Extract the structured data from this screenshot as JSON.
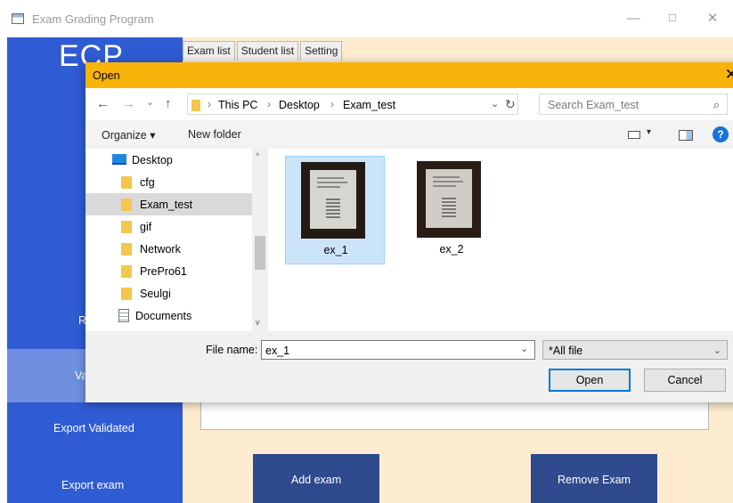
{
  "window": {
    "title": "Exam Grading Program",
    "minimize_glyph": "—",
    "maximize_glyph": "☐",
    "close_glyph": "✕"
  },
  "sidebar": {
    "logo": "ECP",
    "items": [
      {
        "label": "R"
      },
      {
        "label": "Va"
      },
      {
        "label": "Export Validated"
      },
      {
        "label": "Export exam"
      }
    ]
  },
  "tabs": [
    "Exam list",
    "Student list",
    "Setting"
  ],
  "buttons": {
    "add_exam": "Add exam",
    "remove_exam": "Remove Exam"
  },
  "dialog": {
    "title": "Open",
    "close_glyph": "✕",
    "nav": {
      "back": "←",
      "forward": "→",
      "recent": "⌄",
      "up": "↑"
    },
    "breadcrumb": [
      "This PC",
      "Desktop",
      "Exam_test"
    ],
    "breadcrumb_sep": "›",
    "address_drop": "⌄",
    "refresh": "↻",
    "search_placeholder": "Search Exam_test",
    "search_icon": "⌕",
    "toolbar": {
      "organize": "Organize ▾",
      "new_folder": "New folder",
      "view_caret": "▾",
      "help": "?"
    },
    "tree": [
      {
        "label": "Desktop",
        "icon": "desktop-icon"
      },
      {
        "label": "cfg",
        "icon": "folder-icon"
      },
      {
        "label": "Exam_test",
        "icon": "folder-icon",
        "selected": true
      },
      {
        "label": "gif",
        "icon": "folder-icon"
      },
      {
        "label": "Network",
        "icon": "folder-icon"
      },
      {
        "label": "PrePro61",
        "icon": "folder-icon"
      },
      {
        "label": "Seulgi",
        "icon": "folder-icon"
      },
      {
        "label": "Documents",
        "icon": "document-icon"
      }
    ],
    "tree_scroll": {
      "up": "^",
      "down": "v"
    },
    "files": [
      {
        "name": "ex_1",
        "selected": true
      },
      {
        "name": "ex_2",
        "selected": false
      }
    ],
    "file_name_label": "File name:",
    "file_name_value": "ex_1",
    "file_name_drop": "⌄",
    "filter_value": "*All file",
    "filter_caret": "⌄",
    "open_label": "Open",
    "cancel_label": "Cancel"
  },
  "colors": {
    "sidebar": "#2f5bd3",
    "dialog_title": "#f8b40a",
    "content": "#fdecd0",
    "action_button": "#2f4a8d"
  }
}
